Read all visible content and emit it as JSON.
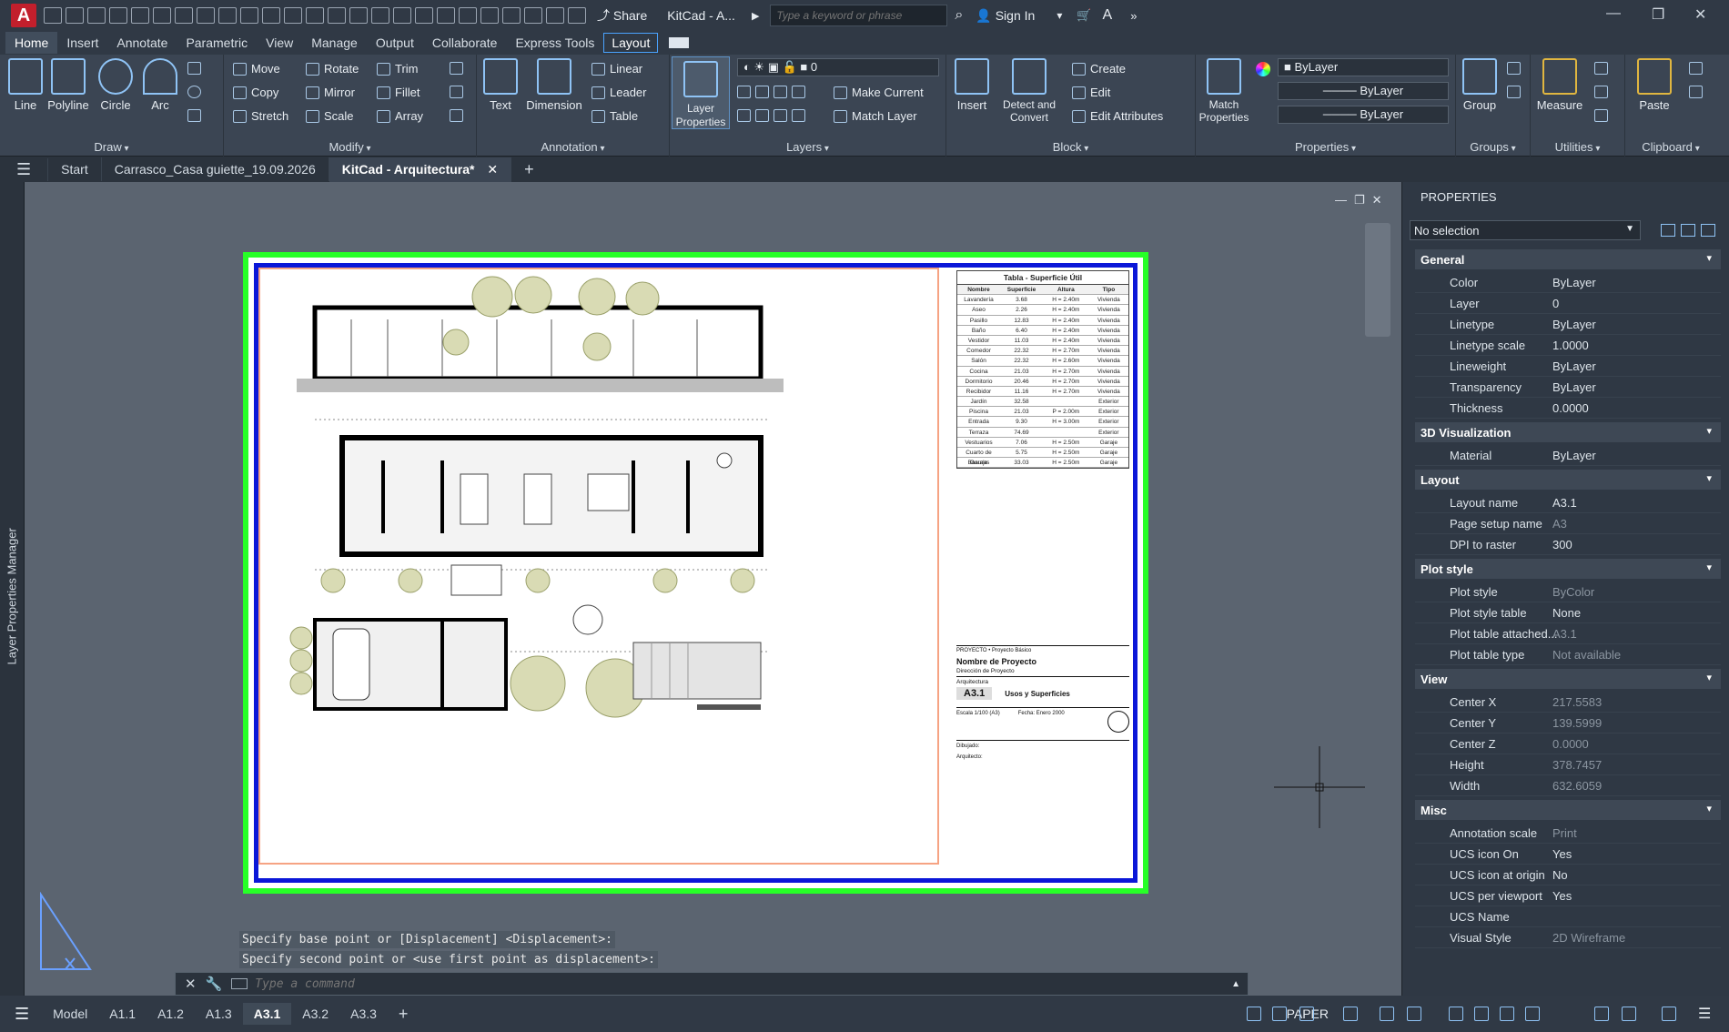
{
  "qat": {
    "app_logo": "A",
    "share": "Share",
    "window_title": "KitCad - A...",
    "search_placeholder": "Type a keyword or phrase",
    "sign_in": "Sign In"
  },
  "ribbon_tabs": [
    "Home",
    "Insert",
    "Annotate",
    "Parametric",
    "View",
    "Manage",
    "Output",
    "Collaborate",
    "Express Tools",
    "Layout"
  ],
  "ribbon": {
    "draw": {
      "title": "Draw",
      "line": "Line",
      "polyline": "Polyline",
      "circle": "Circle",
      "arc": "Arc"
    },
    "modify": {
      "title": "Modify",
      "move": "Move",
      "rotate": "Rotate",
      "trim": "Trim",
      "copy": "Copy",
      "mirror": "Mirror",
      "fillet": "Fillet",
      "stretch": "Stretch",
      "scale": "Scale",
      "array": "Array"
    },
    "annotation": {
      "title": "Annotation",
      "text": "Text",
      "dimension": "Dimension",
      "linear": "Linear",
      "leader": "Leader",
      "table": "Table"
    },
    "layers": {
      "title": "Layers",
      "layer_properties": "Layer Properties",
      "current_layer": "0",
      "make_current": "Make Current",
      "match_layer": "Match Layer"
    },
    "block": {
      "title": "Block",
      "insert": "Insert",
      "detect_convert": "Detect and Convert",
      "create": "Create",
      "edit": "Edit",
      "edit_attributes": "Edit Attributes"
    },
    "properties": {
      "title": "Properties",
      "match_properties": "Match Properties",
      "color": "ByLayer",
      "lineweight": "ByLayer",
      "linetype": "ByLayer"
    },
    "groups": {
      "title": "Groups",
      "group": "Group"
    },
    "utilities": {
      "title": "Utilities",
      "measure": "Measure"
    },
    "clipboard": {
      "title": "Clipboard",
      "paste": "Paste"
    }
  },
  "doc_tabs": {
    "start": "Start",
    "tab1": "Carrasco_Casa guiette_19.09.2026",
    "tab2": "KitCad - Arquitectura*"
  },
  "left_palette": "Layer Properties Manager",
  "sheet": {
    "table_title": "Tabla - Superficie Útil",
    "table_headers": [
      "Nombre",
      "Superficie",
      "Altura",
      "Tipo"
    ],
    "table_rows": [
      [
        "Lavandería",
        "3.68",
        "H = 2.40m",
        "Vivienda"
      ],
      [
        "Aseo",
        "2.26",
        "H = 2.40m",
        "Vivienda"
      ],
      [
        "Pasillo",
        "12.83",
        "H = 2.40m",
        "Vivienda"
      ],
      [
        "Baño",
        "6.40",
        "H = 2.40m",
        "Vivienda"
      ],
      [
        "Vestidor",
        "11.03",
        "H = 2.40m",
        "Vivienda"
      ],
      [
        "Comedor",
        "22.32",
        "H = 2.70m",
        "Vivienda"
      ],
      [
        "Salón",
        "22.32",
        "H = 2.60m",
        "Vivienda"
      ],
      [
        "Cocina",
        "21.03",
        "H = 2.70m",
        "Vivienda"
      ],
      [
        "Dormitorio",
        "20.46",
        "H = 2.70m",
        "Vivienda"
      ],
      [
        "Recibidor",
        "11.16",
        "H = 2.70m",
        "Vivienda"
      ],
      [
        "Jardín",
        "32.58",
        "",
        "Exterior"
      ],
      [
        "Piscina",
        "21.03",
        "P = 2.00m",
        "Exterior"
      ],
      [
        "Entrada",
        "9.30",
        "H = 3.00m",
        "Exterior"
      ],
      [
        "Terraza",
        "74.69",
        "",
        "Exterior"
      ],
      [
        "Vestuarios",
        "7.06",
        "H = 2.50m",
        "Garaje"
      ],
      [
        "Cuarto de Basuras",
        "5.75",
        "H = 2.50m",
        "Garaje"
      ],
      [
        "Garaje",
        "33.03",
        "H = 2.50m",
        "Garaje"
      ]
    ],
    "tb_project": "PROYECTO • Proyecto Básico",
    "tb_name": "Nombre de Proyecto",
    "tb_address": "Dirección de Proyecto",
    "tb_discipline": "Arquitectura",
    "tb_sheet": "A3.1",
    "tb_sheet_title": "Usos y Superficies",
    "tb_scale": "Escala 1/100 (A3)",
    "tb_date": "Fecha: Enero 2000",
    "tb_drawn": "Dibujado:",
    "tb_author": "Arquitecto:"
  },
  "command": {
    "line1": "Specify base point or [Displacement] <Displacement>:",
    "line2": "Specify second point or <use first point as displacement>:",
    "placeholder": "Type a command"
  },
  "properties_panel": {
    "title": "PROPERTIES",
    "selection": "No selection",
    "sections": {
      "general": "General",
      "viz3d": "3D Visualization",
      "layout": "Layout",
      "plotstyle": "Plot style",
      "view": "View",
      "misc": "Misc"
    },
    "general": [
      [
        "Color",
        "ByLayer"
      ],
      [
        "Layer",
        "0"
      ],
      [
        "Linetype",
        "ByLayer"
      ],
      [
        "Linetype scale",
        "1.0000"
      ],
      [
        "Lineweight",
        "ByLayer"
      ],
      [
        "Transparency",
        "ByLayer"
      ],
      [
        "Thickness",
        "0.0000"
      ]
    ],
    "viz3d": [
      [
        "Material",
        "ByLayer"
      ]
    ],
    "layout": [
      [
        "Layout name",
        "A3.1"
      ],
      [
        "Page setup name",
        "A3"
      ],
      [
        "DPI to raster",
        "300"
      ]
    ],
    "plotstyle": [
      [
        "Plot style",
        "ByColor"
      ],
      [
        "Plot style table",
        "None"
      ],
      [
        "Plot table attached...",
        "A3.1"
      ],
      [
        "Plot table type",
        "Not available"
      ]
    ],
    "view": [
      [
        "Center X",
        "217.5583"
      ],
      [
        "Center Y",
        "139.5999"
      ],
      [
        "Center Z",
        "0.0000"
      ],
      [
        "Height",
        "378.7457"
      ],
      [
        "Width",
        "632.6059"
      ]
    ],
    "misc": [
      [
        "Annotation scale",
        "Print"
      ],
      [
        "UCS icon On",
        "Yes"
      ],
      [
        "UCS icon at origin",
        "No"
      ],
      [
        "UCS per viewport",
        "Yes"
      ],
      [
        "UCS Name",
        ""
      ],
      [
        "Visual Style",
        "2D Wireframe"
      ]
    ]
  },
  "layout_tabs": [
    "Model",
    "A1.1",
    "A1.2",
    "A1.3",
    "A3.1",
    "A3.2",
    "A3.3"
  ],
  "status": {
    "paper": "PAPER"
  }
}
